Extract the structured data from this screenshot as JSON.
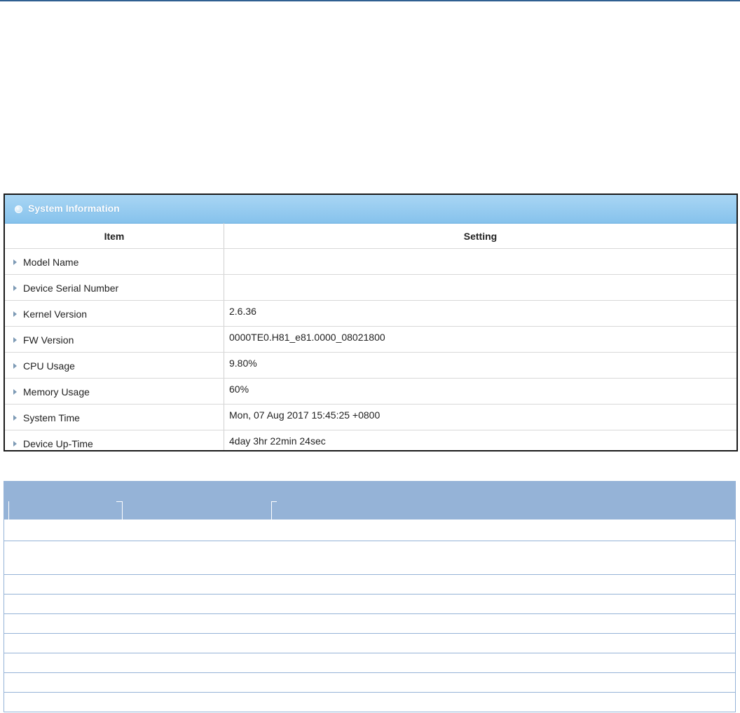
{
  "panel": {
    "title": "System Information",
    "columns": {
      "item": "Item",
      "setting": "Setting"
    },
    "rows": [
      {
        "label": "Model Name",
        "value": ""
      },
      {
        "label": "Device Serial Number",
        "value": ""
      },
      {
        "label": "Kernel Version",
        "value": "2.6.36"
      },
      {
        "label": "FW Version",
        "value": "0000TE0.H81_e81.0000_08021800"
      },
      {
        "label": "CPU Usage",
        "value": "9.80%"
      },
      {
        "label": "Memory Usage",
        "value": "60%"
      },
      {
        "label": "System Time",
        "value": "Mon, 07 Aug 2017 15:45:25 +0800"
      },
      {
        "label": "Device Up-Time",
        "value": "4day 3hr 22min 24sec"
      }
    ]
  },
  "colors": {
    "header_gradient_top": "#a9d6f4",
    "header_gradient_bottom": "#86c2ec",
    "description_table": "#95b3d7",
    "top_rule": "#2f5f91"
  }
}
